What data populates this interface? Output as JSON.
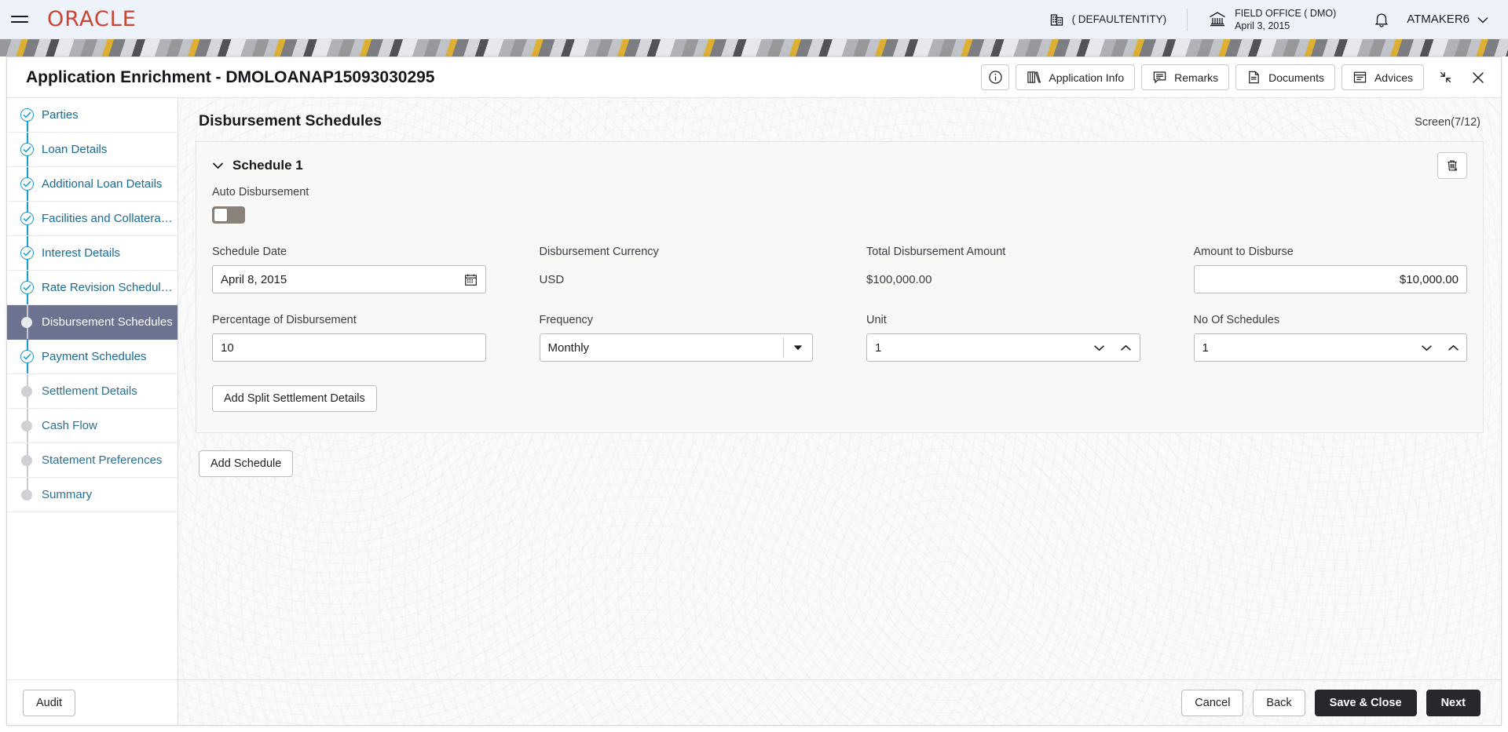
{
  "topbar": {
    "menu_icon": "hamburger-icon",
    "brand": "ORACLE",
    "entity": "( DEFAULTENTITY)",
    "entity_icon": "building-icon",
    "office_icon": "bank-icon",
    "office_name": "FIELD OFFICE ( DMO)",
    "office_date": "April 3, 2015",
    "bell_icon": "bell-icon",
    "user": "ATMAKER6",
    "user_caret_icon": "chevron-down-icon"
  },
  "window": {
    "title": "Application Enrichment - DMOLOANAP15093030295",
    "toolbar": [
      {
        "label": "",
        "icon": "info-icon",
        "icon_only": true,
        "name": "info-button"
      },
      {
        "label": "Application Info",
        "icon": "book-icon",
        "icon_only": false,
        "name": "application-info-button"
      },
      {
        "label": "Remarks",
        "icon": "comment-icon",
        "icon_only": false,
        "name": "remarks-button"
      },
      {
        "label": "Documents",
        "icon": "document-icon",
        "icon_only": false,
        "name": "documents-button"
      },
      {
        "label": "Advices",
        "icon": "advice-icon",
        "icon_only": false,
        "name": "advices-button"
      }
    ],
    "minimize_icon": "collapse-icon",
    "close_icon": "close-icon"
  },
  "sidebar": {
    "items": [
      {
        "label": "Parties",
        "state": "done"
      },
      {
        "label": "Loan Details",
        "state": "done"
      },
      {
        "label": "Additional Loan Details",
        "state": "done"
      },
      {
        "label": "Facilities and Collateral ...",
        "state": "done"
      },
      {
        "label": "Interest Details",
        "state": "done"
      },
      {
        "label": "Rate Revision Schedules",
        "state": "done"
      },
      {
        "label": "Disbursement Schedules",
        "state": "active"
      },
      {
        "label": "Payment Schedules",
        "state": "done"
      },
      {
        "label": "Settlement Details",
        "state": "future"
      },
      {
        "label": "Cash Flow",
        "state": "future"
      },
      {
        "label": "Statement Preferences",
        "state": "future"
      },
      {
        "label": "Summary",
        "state": "future"
      }
    ],
    "audit_label": "Audit"
  },
  "main": {
    "page_title": "Disbursement Schedules",
    "screen_indicator": "Screen(7/12)",
    "card": {
      "collapse_icon": "chevron-down-icon",
      "title": "Schedule 1",
      "delete_icon": "trash-icon",
      "auto_disbursement_label": "Auto Disbursement",
      "auto_disbursement_on": false,
      "fields": {
        "schedule_date": {
          "label": "Schedule Date",
          "value": "April 8, 2015",
          "icon": "calendar-icon"
        },
        "disbursement_currency": {
          "label": "Disbursement Currency",
          "value": "USD"
        },
        "total_disbursement_amount": {
          "label": "Total Disbursement Amount",
          "value": "$100,000.00"
        },
        "amount_to_disburse": {
          "label": "Amount to Disburse",
          "value": "$10,000.00"
        },
        "percentage_of_disbursement": {
          "label": "Percentage of Disbursement",
          "value": "10"
        },
        "frequency": {
          "label": "Frequency",
          "value": "Monthly",
          "caret_icon": "caret-down-icon"
        },
        "unit": {
          "label": "Unit",
          "value": "1",
          "down_icon": "chevron-down-icon",
          "up_icon": "chevron-up-icon"
        },
        "no_of_schedules": {
          "label": "No Of Schedules",
          "value": "1",
          "down_icon": "chevron-down-icon",
          "up_icon": "chevron-up-icon"
        }
      },
      "split_settlement_label": "Add Split Settlement Details"
    },
    "add_schedule_label": "Add Schedule"
  },
  "footer": {
    "cancel": "Cancel",
    "back": "Back",
    "save_close": "Save & Close",
    "next": "Next"
  },
  "colors": {
    "brand": "#C74634",
    "link": "#1a6a94",
    "active_bg": "#6b7391",
    "step_done": "#1b9bd1",
    "dark_button": "#26282c"
  }
}
